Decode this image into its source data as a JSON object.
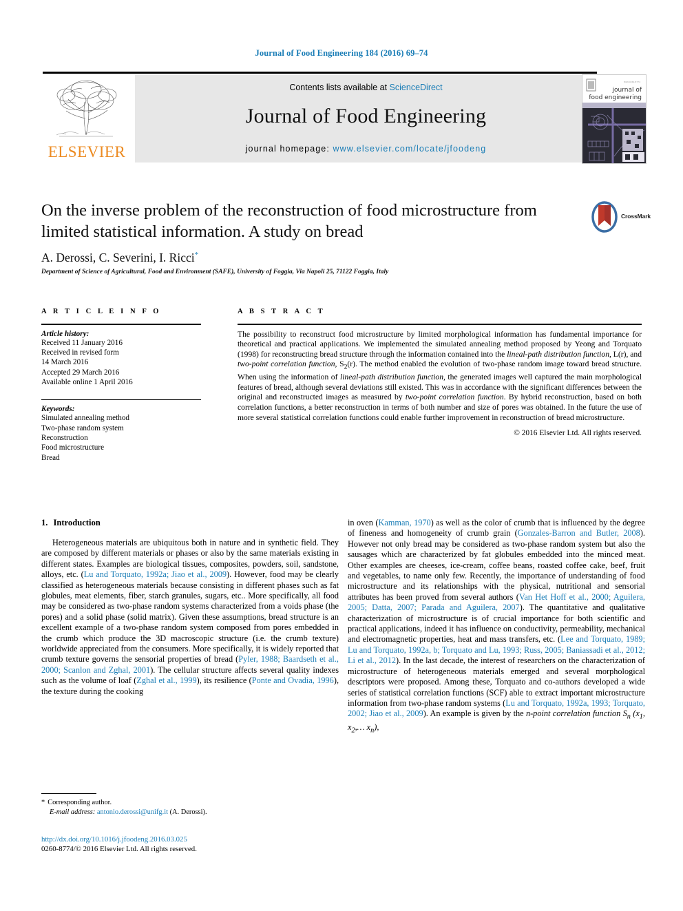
{
  "running_head": "Journal of Food Engineering 184 (2016) 69–74",
  "masthead": {
    "contents_prefix": "Contents lists available at ",
    "sciencedirect": "ScienceDirect",
    "journal_title": "Journal of Food Engineering",
    "homepage_prefix": "journal homepage: ",
    "homepage_url": "www.elsevier.com/locate/jfoodeng",
    "publisher": "ELSEVIER",
    "cover_line1": "journal of",
    "cover_line2": "food engineering"
  },
  "article": {
    "title": "On the inverse problem of the reconstruction of food microstructure from limited statistical information. A study on bread",
    "authors": "A. Derossi, C. Severini, I. Ricci",
    "author_marker": "*",
    "affiliation": "Department of Science of Agricultural, Food and Environment (SAFE), University of Foggia, Via Napoli 25, 71122 Foggia, Italy",
    "crossmark_label": "CrossMark"
  },
  "info": {
    "heading": "A R T I C L E   I N F O",
    "history_label": "Article history:",
    "history": [
      "Received 11 January 2016",
      "Received in revised form",
      "14 March 2016",
      "Accepted 29 March 2016",
      "Available online 1 April 2016"
    ],
    "keywords_label": "Keywords:",
    "keywords": [
      "Simulated annealing method",
      "Two-phase random system",
      "Reconstruction",
      "Food microstructure",
      "Bread"
    ]
  },
  "abstract": {
    "heading": "A B S T R A C T",
    "copyright": "© 2016 Elsevier Ltd. All rights reserved."
  },
  "introduction": {
    "heading_number": "1.",
    "heading_title": "Introduction"
  },
  "footnote": {
    "corresponding": "Corresponding author.",
    "email_label": "E-mail address:",
    "email": "antonio.derossi@unifg.it",
    "email_owner": "(A. Derossi)."
  },
  "publication": {
    "doi": "http://dx.doi.org/10.1016/j.jfoodeng.2016.03.025",
    "issn_line": "0260-8774/© 2016 Elsevier Ltd. All rights reserved."
  },
  "colors": {
    "link": "#1a7db6",
    "elsevier_orange": "#ec8b22",
    "masthead_grey": "#e7e7e7"
  }
}
